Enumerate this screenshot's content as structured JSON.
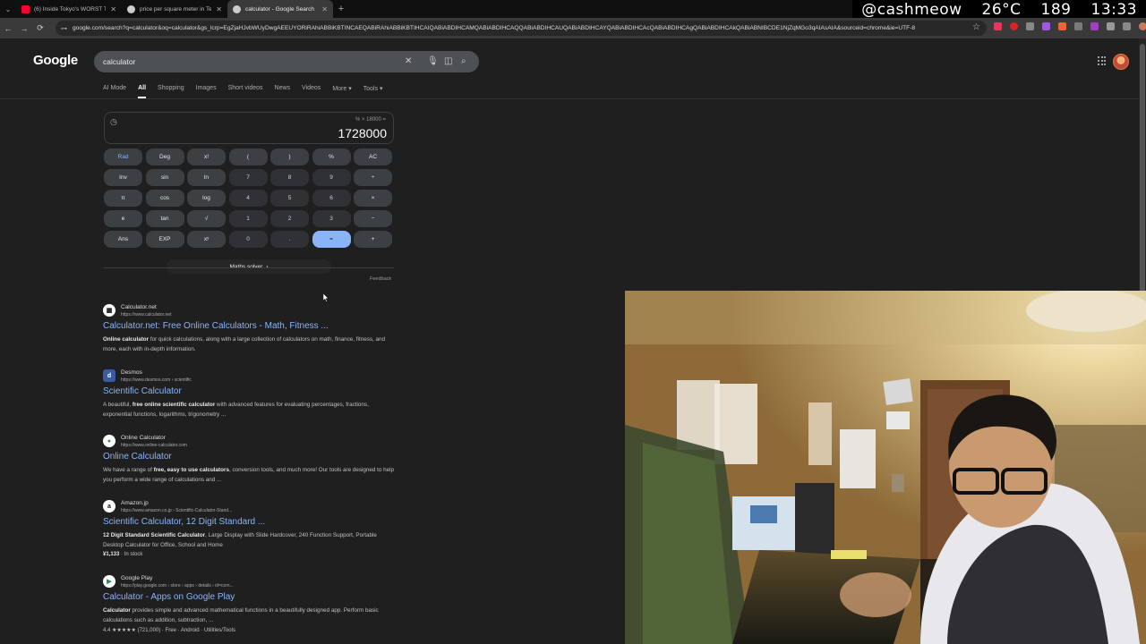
{
  "tabs": [
    {
      "title": "(6) Inside Tokyo's WORST TINY",
      "favicon_color": "#ff0033",
      "active": false
    },
    {
      "title": "price per square meter in Tel A",
      "favicon_color": "#cccccc",
      "active": false
    },
    {
      "title": "calculator - Google Search",
      "favicon_color": "#cccccc",
      "active": true
    }
  ],
  "overlay": {
    "handle": "@cashmeow",
    "temperature": "26°C",
    "count": "189",
    "time": "13:33"
  },
  "address_bar": {
    "url": "google.com/search?q=calculator&oq=calculator&gs_lcrp=EgZjaHJvbWUyDwgAEEUYORiRAhiABBiKBTINCAEQABiRAhiABBiKBTIHCAIQABiABDIHCAMQABiABDIHCAQQABiABDIHCAUQABiABDIHCAYQABiABDIHCAcQABiABDIHCAgQABiABDIHCAkQABiABNIBCDE1NjZqMGo3qAIAsAIA&sourceid=chrome&ie=UTF-8"
  },
  "google": {
    "logo": "Google",
    "query": "calculator",
    "nav_tabs": [
      "AI Mode",
      "All",
      "Shopping",
      "Images",
      "Short videos",
      "News",
      "Videos",
      "More ▾",
      "Tools ▾"
    ],
    "active_tab": "All"
  },
  "calculator": {
    "expression": "% × 18000 =",
    "result": "1728000",
    "keys": [
      [
        "Rad",
        "Deg",
        "x!",
        "(",
        ")",
        "%",
        "AC"
      ],
      [
        "Inv",
        "sin",
        "ln",
        "7",
        "8",
        "9",
        "÷"
      ],
      [
        "π",
        "cos",
        "log",
        "4",
        "5",
        "6",
        "×"
      ],
      [
        "e",
        "tan",
        "√",
        "1",
        "2",
        "3",
        "−"
      ],
      [
        "Ans",
        "EXP",
        "xʸ",
        "0",
        ".",
        "=",
        "+"
      ]
    ],
    "maths_solver": "Maths solver",
    "feedback": "Feedback"
  },
  "results": [
    {
      "site": "Calculator.net",
      "url": "https://www.calculator.net",
      "favicon": "▦",
      "title": "Calculator.net: Free Online Calculators - Math, Fitness ...",
      "snippet_bold": "Online calculator",
      "snippet": " for quick calculations, along with a large collection of calculators on math, finance, fitness, and more, each with in-depth information."
    },
    {
      "site": "Desmos",
      "url": "https://www.desmos.com › scientific",
      "favicon": "d",
      "title": "Scientific Calculator",
      "snippet_pre": "A beautiful, ",
      "snippet_bold": "free online scientific calculator",
      "snippet": " with advanced features for evaluating percentages, fractions, exponential functions, logarithms, trigonometry ..."
    },
    {
      "site": "Online Calculator",
      "url": "https://www.online-calculator.com",
      "favicon": "●",
      "title": "Online Calculator",
      "snippet_pre": "We have a range of ",
      "snippet_bold": "free, easy to use calculators",
      "snippet": ", conversion tools, and much more! Our tools are designed to help you perform a wide range of calculations and ..."
    },
    {
      "site": "Amazon.jp",
      "url": "https://www.amazon.co.jp › Scientific-Calculator-Stand...",
      "favicon": "a",
      "title": "Scientific Calculator, 12 Digit Standard ...",
      "snippet_bold": "12 Digit Standard Scientific Calculator",
      "snippet": ", Large Display with Slide Hardcover, 240 Function Support, Portable Desktop Calculator for Office, School and Home",
      "price": "¥1,133",
      "stock": "In stock"
    },
    {
      "site": "Google Play",
      "url": "https://play.google.com › store › apps › details › id=com...",
      "favicon": "▶",
      "title": "Calculator - Apps on Google Play",
      "snippet_bold": "Calculator",
      "snippet": " provides simple and advanced mathematical functions in a beautifully designed app. Perform basic calculations such as addition, subtraction, ...",
      "rating": "4.4 ★★★★★ (721,000) · Free · Android · Utilities/Tools"
    }
  ]
}
